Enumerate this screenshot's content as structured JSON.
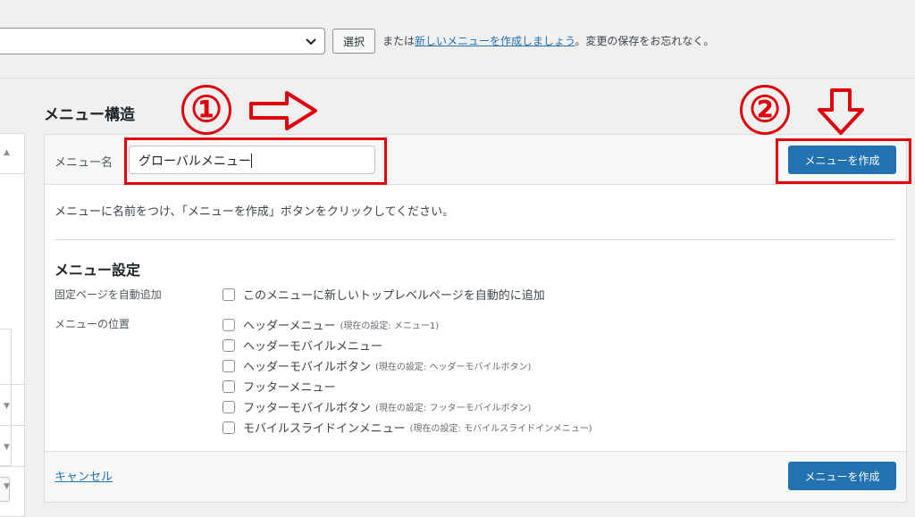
{
  "top_bar": {
    "select_button": "選択",
    "text_before": "または",
    "create_link": "新しいメニューを作成しましょう",
    "text_after": "。変更の保存をお忘れなく。"
  },
  "section_title": "メニュー構造",
  "menu_name": {
    "label": "メニュー名",
    "value": "グローバルメニュー"
  },
  "create_button_label": "メニューを作成",
  "description": "メニューに名前をつけ、「メニューを作成」ボタンをクリックしてください。",
  "settings": {
    "title": "メニュー設定",
    "auto_add_label": "固定ページを自動追加",
    "auto_add_option": "このメニューに新しいトップレベルページを自動的に追加",
    "location_label": "メニューの位置",
    "locations": [
      {
        "name": "ヘッダーメニュー",
        "note": "(現在の設定: メニュー1)"
      },
      {
        "name": "ヘッダーモバイルメニュー",
        "note": ""
      },
      {
        "name": "ヘッダーモバイルボタン",
        "note": "(現在の設定: ヘッダーモバイルボタン)"
      },
      {
        "name": "フッターメニュー",
        "note": ""
      },
      {
        "name": "フッターモバイルボタン",
        "note": "(現在の設定: フッターモバイルボタン)"
      },
      {
        "name": "モバイルスライドインメニュー",
        "note": "(現在の設定: モバイルスライドインメニュー)"
      }
    ]
  },
  "footer": {
    "cancel": "キャンセル",
    "create": "メニューを作成"
  },
  "annotations": {
    "step1": "①",
    "step2": "②",
    "color": "#e0000b"
  },
  "colors": {
    "primary_button": "#2271b1",
    "link": "#2271b1"
  }
}
